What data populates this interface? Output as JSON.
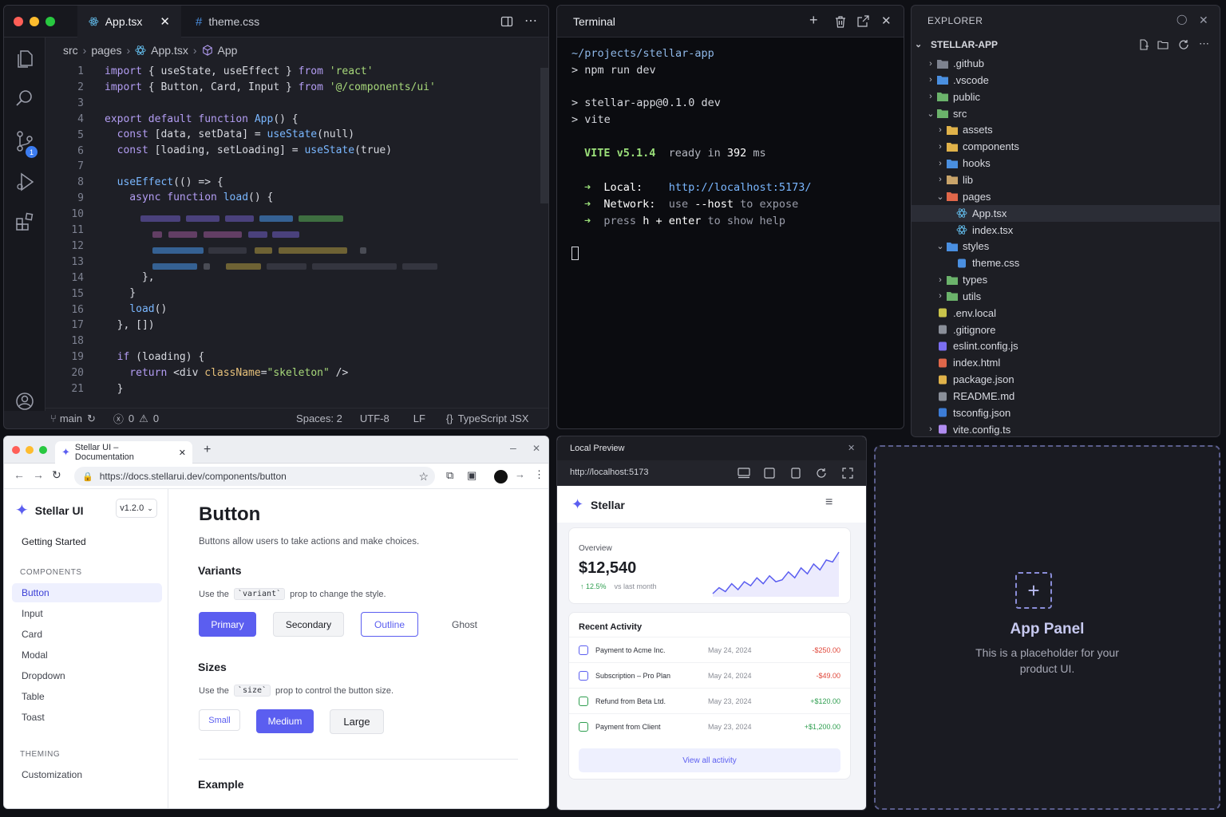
{
  "editor": {
    "tabs": [
      {
        "label": "App.tsx"
      },
      {
        "label": "theme.css"
      }
    ],
    "breadcrumb": [
      "src",
      "pages",
      "App.tsx",
      "App"
    ],
    "line_numbers": [
      "1",
      "2",
      "3",
      "4",
      "5",
      "6",
      "7",
      "8",
      "9",
      "10",
      "11",
      "12",
      "13",
      "14",
      "15",
      "16",
      "17",
      "18",
      "19",
      "20",
      "21"
    ],
    "code": {
      "l1": [
        "import",
        " { useState, useEffect } ",
        "from",
        " 'react'"
      ],
      "l2": [
        "import",
        " { Button, Card, Input } ",
        "from",
        " '@/components/ui'"
      ],
      "l4": [
        "export default function",
        " App",
        "() {"
      ],
      "l5": [
        "  const",
        " [data, setData] = ",
        "useState",
        "(null)"
      ],
      "l6": [
        "  const",
        " [loading, setLoading] = ",
        "useState",
        "(true)"
      ],
      "l8": [
        "  useEffect",
        "(() => {"
      ],
      "l9": [
        "    async function",
        " load",
        "() {"
      ],
      "l14": [
        "      },"
      ],
      "l15": [
        "    }"
      ],
      "l16": [
        "    load",
        "()"
      ],
      "l17": [
        "  }, [])"
      ],
      "l19": [
        "  if",
        " (loading) {"
      ],
      "l20": [
        "    return",
        " <div ",
        "className",
        "=",
        "\"skeleton\"",
        " />"
      ],
      "l21": [
        "  }"
      ]
    },
    "status": {
      "branch": "main",
      "errors": "0",
      "warnings": "0",
      "spaces": "Spaces: 2",
      "encoding": "UTF-8",
      "eol": "LF",
      "language": "TypeScript JSX"
    },
    "badge": "1"
  },
  "terminal": {
    "title": "Terminal",
    "cwd": "~/projects/stellar-app",
    "cmd": "> npm run dev",
    "out1": "> stellar-app@0.1.0 dev",
    "out2": "> vite",
    "vite": "VITE v5.1.4",
    "ready": "ready in",
    "ms": "392",
    "ms_unit": "ms",
    "local_label": "Local:",
    "local_url": "http://localhost:5173/",
    "network_label": "Network:",
    "network_text_a": "use",
    "network_text_b": "--host",
    "network_text_c": "to expose",
    "help_a": "press",
    "help_b": "h",
    "help_c": "+",
    "help_d": "enter",
    "help_e": "to show help",
    "arrow": "➜"
  },
  "explorer": {
    "title": "EXPLORER",
    "root": "STELLAR-APP",
    "items": [
      {
        "label": ".github",
        "type": "folder",
        "depth": 0,
        "open": false,
        "color": "#7d828f"
      },
      {
        "label": ".vscode",
        "type": "folder",
        "depth": 0,
        "open": false,
        "color": "#4a8fe0"
      },
      {
        "label": "public",
        "type": "folder",
        "depth": 0,
        "open": false,
        "color": "#6bb36b"
      },
      {
        "label": "src",
        "type": "folder",
        "depth": 0,
        "open": true,
        "color": "#6bb36b"
      },
      {
        "label": "assets",
        "type": "folder",
        "depth": 1,
        "open": false,
        "color": "#e0b24a"
      },
      {
        "label": "components",
        "type": "folder",
        "depth": 1,
        "open": false,
        "color": "#e0b24a"
      },
      {
        "label": "hooks",
        "type": "folder",
        "depth": 1,
        "open": false,
        "color": "#4a8fe0"
      },
      {
        "label": "lib",
        "type": "folder",
        "depth": 1,
        "open": false,
        "color": "#c9a46a"
      },
      {
        "label": "pages",
        "type": "folder",
        "depth": 1,
        "open": true,
        "color": "#e0674a"
      },
      {
        "label": "App.tsx",
        "type": "react",
        "depth": 2,
        "selected": true,
        "color": "#61b8e6"
      },
      {
        "label": "index.tsx",
        "type": "react",
        "depth": 2,
        "color": "#61b8e6"
      },
      {
        "label": "styles",
        "type": "folder",
        "depth": 1,
        "open": true,
        "color": "#4a8fe0"
      },
      {
        "label": "theme.css",
        "type": "css",
        "depth": 2,
        "color": "#4a8fe0"
      },
      {
        "label": "types",
        "type": "folder",
        "depth": 1,
        "open": false,
        "color": "#6bb36b"
      },
      {
        "label": "utils",
        "type": "folder",
        "depth": 1,
        "open": false,
        "color": "#6bb36b"
      },
      {
        "label": ".env.local",
        "type": "env",
        "depth": 0,
        "color": "#c9c34a"
      },
      {
        "label": ".gitignore",
        "type": "git",
        "depth": 0,
        "color": "#8a8f99"
      },
      {
        "label": "eslint.config.js",
        "type": "eslint",
        "depth": 0,
        "color": "#7b6ef0"
      },
      {
        "label": "index.html",
        "type": "html",
        "depth": 0,
        "color": "#e0674a"
      },
      {
        "label": "package.json",
        "type": "json",
        "depth": 0,
        "color": "#e0b24a"
      },
      {
        "label": "README.md",
        "type": "md",
        "depth": 0,
        "color": "#8a8f99"
      },
      {
        "label": "tsconfig.json",
        "type": "ts",
        "depth": 0,
        "color": "#3c7cd6"
      },
      {
        "label": "vite.config.ts",
        "type": "vite",
        "depth": 0,
        "open": false,
        "color": "#b08cf0"
      }
    ]
  },
  "browser": {
    "tab_title": "Stellar UI – Documentation",
    "url": "https://docs.stellarui.dev/components/button",
    "brand": "Stellar UI",
    "version": "v1.2.0",
    "nav": {
      "getting_started": "Getting Started",
      "components_heading": "COMPONENTS",
      "components": [
        "Button",
        "Input",
        "Card",
        "Modal",
        "Dropdown",
        "Table",
        "Toast"
      ],
      "theming_heading": "THEMING",
      "theming": [
        "Customization"
      ]
    },
    "page": {
      "title": "Button",
      "subtitle": "Buttons allow users to take actions and make choices.",
      "variants_heading": "Variants",
      "variants_desc_a": "Use the",
      "variants_desc_code": "`variant`",
      "variants_desc_b": "prop to change the style.",
      "variants": [
        "Primary",
        "Secondary",
        "Outline",
        "Ghost"
      ],
      "sizes_heading": "Sizes",
      "sizes_desc_a": "Use the",
      "sizes_desc_code": "`size`",
      "sizes_desc_b": "prop to control the button size.",
      "sizes": [
        "Small",
        "Medium",
        "Large"
      ],
      "example_heading": "Example"
    }
  },
  "preview": {
    "title": "Local Preview",
    "url": "http://localhost:5173",
    "brand": "Stellar",
    "overview_label": "Overview",
    "overview_value": "$12,540",
    "overview_change": "↑ 12.5%",
    "overview_period": "vs last month",
    "sparkline": [
      3,
      6,
      4,
      8,
      5,
      9,
      7,
      11,
      8,
      12,
      9,
      10,
      14,
      11,
      16,
      13,
      18,
      15,
      20,
      19,
      24
    ],
    "activity_heading": "Recent Activity",
    "activity": [
      {
        "desc": "Payment to Acme Inc.",
        "date": "May 24, 2024",
        "amount": "-$250.00",
        "kind": "out"
      },
      {
        "desc": "Subscription – Pro Plan",
        "date": "May 24, 2024",
        "amount": "-$49.00",
        "kind": "out"
      },
      {
        "desc": "Refund from Beta Ltd.",
        "date": "May 23, 2024",
        "amount": "+$120.00",
        "kind": "in"
      },
      {
        "desc": "Payment from Client",
        "date": "May 23, 2024",
        "amount": "+$1,200.00",
        "kind": "in"
      }
    ],
    "view_all": "View all activity"
  },
  "app_panel": {
    "title": "App Panel",
    "desc_1": "This is a placeholder for your",
    "desc_2": "product UI."
  },
  "colors": {
    "accent": "#5b5ef0",
    "terminal_green": "#9be07a",
    "negative": "#e0473a",
    "positive": "#2e9e4f"
  }
}
